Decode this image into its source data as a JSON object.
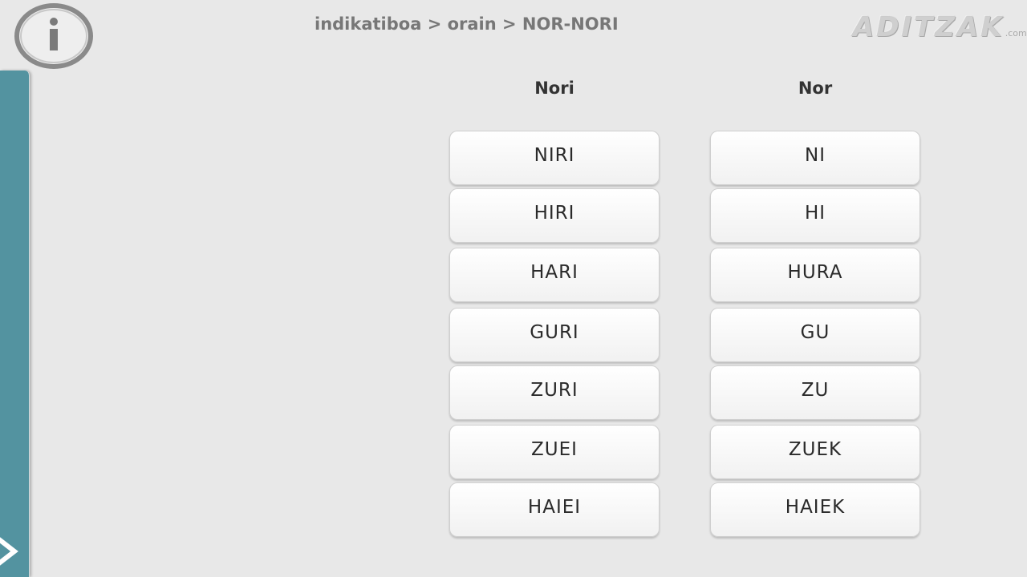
{
  "header": {
    "breadcrumb": "indikatiboa > orain > NOR-NORI",
    "logo_main": "ADITZAK",
    "logo_suffix": ".com",
    "info_icon": "info-circle-icon"
  },
  "columns": {
    "nori": {
      "title": "Nori",
      "items": [
        "NIRI",
        "HIRI",
        "HARI",
        "GURI",
        "ZURI",
        "ZUEI",
        "HAIEI"
      ]
    },
    "nor": {
      "title": "Nor",
      "items": [
        "NI",
        "HI",
        "HURA",
        "GU",
        "ZU",
        "ZUEK",
        "HAIEK"
      ]
    }
  },
  "side_panel": {
    "icon": "chevron-right-icon"
  },
  "colors": {
    "background": "#e8e8e8",
    "side_panel": "#5393a0",
    "breadcrumb_text": "#777777",
    "button_text": "#2a2a2a"
  }
}
